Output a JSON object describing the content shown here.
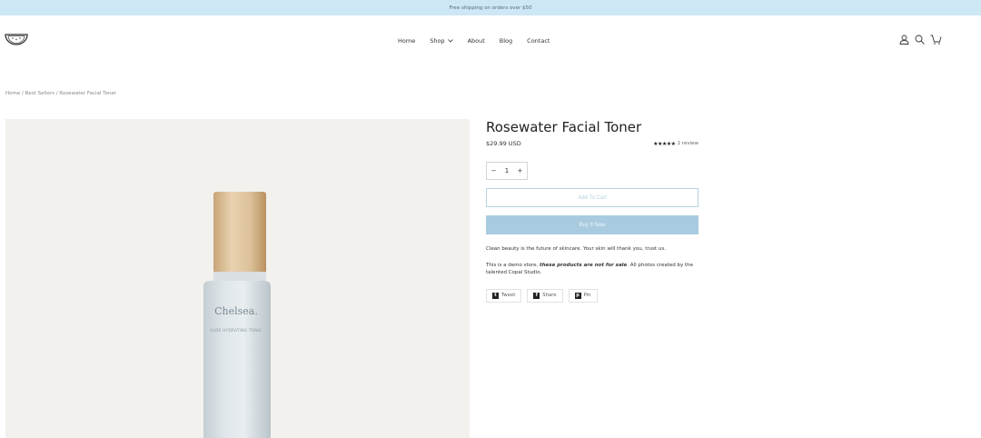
{
  "announcement": "Free shipping on orders over $50",
  "nav": {
    "home": "Home",
    "shop": "Shop",
    "about": "About",
    "blog": "Blog",
    "contact": "Contact"
  },
  "header_icons": [
    "account-icon",
    "search-icon",
    "cart-icon"
  ],
  "breadcrumb": "Home / Best Sellers / Rosewater Facial Toner",
  "product": {
    "title": "Rosewater Facial Toner",
    "price": "$29.99 USD",
    "stars": "★★★★★",
    "rating_count": 5,
    "reviews": "1 review",
    "quantity": "1",
    "qty_minus": "−",
    "qty_plus": "+",
    "add_to_cart": "Add To Cart",
    "buy_now": "Buy It Now",
    "description_1": "Clean beauty is the future of skincare. Your skin will thank you, trust us.",
    "description_2_prefix": "This is a demo store, ",
    "description_2_bold": "these products are not for sale",
    "description_2_suffix": ". All photos created by the talented Copal Studio."
  },
  "image": {
    "brand": "Chelsea.",
    "subtitle": "ALOE HYDRATING TONIC"
  },
  "share": {
    "tweet": "Tweet",
    "share": "Share",
    "pin": "Pin"
  },
  "colors": {
    "announcement_bg": "#cde7f5",
    "accent": "#a9cbe0",
    "image_bg": "#f2f1ee"
  }
}
